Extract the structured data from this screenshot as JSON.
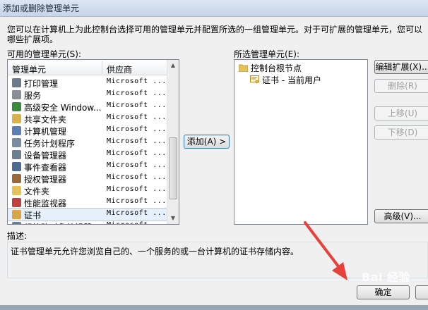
{
  "window": {
    "title": "添加或删除管理单元"
  },
  "intro": {
    "text": "您可以在计算机上为此控制台选择可用的管理单元并配置所选的一组管理单元。对于可扩展的管理单元，您可以\n哪些扩展项。"
  },
  "available": {
    "label": "可用的管理单元(S):",
    "columns": {
      "name": "管理单元",
      "vendor": "供应商"
    },
    "items": [
      {
        "name": "打印管理",
        "vendor": "Microsoft ...",
        "icon": "printer-icon",
        "color": "#6b7b8c"
      },
      {
        "name": "服务",
        "vendor": "Microsoft ...",
        "icon": "gears-icon",
        "color": "#8a8f96"
      },
      {
        "name": "高级安全 Window...",
        "vendor": "Microsoft ...",
        "icon": "firewall-icon",
        "color": "#3c8a3c"
      },
      {
        "name": "共享文件夹",
        "vendor": "Microsoft ...",
        "icon": "shared-folder-icon",
        "color": "#d8b24a"
      },
      {
        "name": "计算机管理",
        "vendor": "Microsoft ...",
        "icon": "computer-management-icon",
        "color": "#5a7fb0"
      },
      {
        "name": "任务计划程序",
        "vendor": "Microsoft ...",
        "icon": "clock-icon",
        "color": "#7a8aa0"
      },
      {
        "name": "设备管理器",
        "vendor": "Microsoft ...",
        "icon": "device-manager-icon",
        "color": "#6d7f92"
      },
      {
        "name": "事件查看器",
        "vendor": "Microsoft ...",
        "icon": "event-viewer-icon",
        "color": "#4d6b8f"
      },
      {
        "name": "授权管理器",
        "vendor": "Microsoft ...",
        "icon": "authorization-icon",
        "color": "#9a6a3a"
      },
      {
        "name": "文件夹",
        "vendor": "Microsoft ...",
        "icon": "folder-icon",
        "color": "#e6c25a"
      },
      {
        "name": "性能监视器",
        "vendor": "Microsoft ...",
        "icon": "performance-icon",
        "color": "#c04040"
      },
      {
        "name": "证书",
        "vendor": "Microsoft ...",
        "icon": "certificate-icon",
        "color": "#d9a54a"
      },
      {
        "name": "组策略对象编辑器",
        "vendor": "Microsoft ...",
        "icon": "policy-icon",
        "color": "#5f7f9f"
      }
    ],
    "selected_index": 11
  },
  "add_button": {
    "label": "添加(A) >"
  },
  "selected": {
    "label": "所选管理单元(E):",
    "root": "控制台根节点",
    "child": "证书 - 当前用户"
  },
  "side_buttons": {
    "edit_ext": "编辑扩展(X)...",
    "remove": "删除(R)",
    "move_up": "上移(U)",
    "move_down": "下移(D)",
    "advanced": "高级(V)..."
  },
  "description": {
    "label": "描述:",
    "text": "证书管理单元允许您浏览自己的、一个服务的或一台计算机的证书存储内容。"
  },
  "footer": {
    "ok": "确定"
  },
  "watermark": {
    "text": "Bai 经验"
  },
  "colors": {
    "annotation_arrow": "#e8403a"
  }
}
